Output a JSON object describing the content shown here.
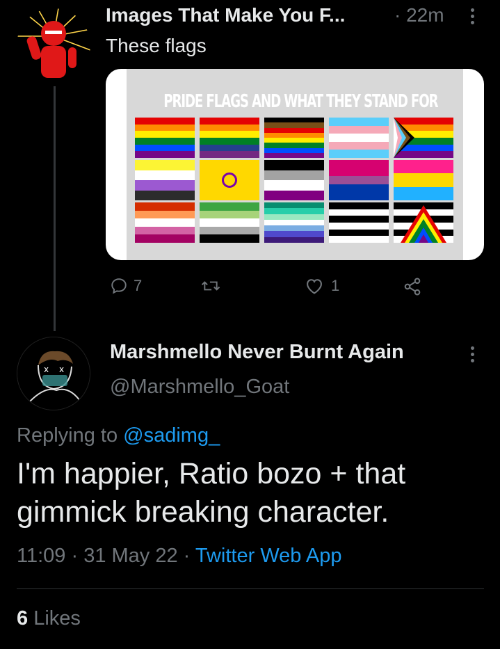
{
  "tweet": {
    "author_name": "Images That Make You F...",
    "time": "· 22m",
    "text": "These flags",
    "image_title": "PRIDE FLAGS AND WHAT THEY STAND FOR",
    "actions": {
      "reply_count": "7",
      "retweet_count": "",
      "like_count": "1"
    }
  },
  "reply": {
    "author_name": "Marshmello Never Burnt Again",
    "handle": "@Marshmello_Goat",
    "replying_prefix": "Replying to ",
    "replying_mention": "@sadimg_",
    "text": "I'm happier, Ratio bozo + that gimmick breaking character.",
    "time": "11:09 · 31 May 22 · ",
    "app": "Twitter Web App",
    "likes_count": "6",
    "likes_label": " Likes"
  },
  "colors": {
    "background": "#000000",
    "text_primary": "#e7e9ea",
    "text_secondary": "#71767b",
    "link": "#1d9bf0",
    "divider": "#2f3336"
  },
  "flags": [
    {
      "name": "rainbow-flag",
      "stripes": [
        "#e40303",
        "#ff8c00",
        "#ffed00",
        "#008026",
        "#004dff",
        "#750787"
      ]
    },
    {
      "name": "rainbow-flag-alt",
      "stripes": [
        "#e40303",
        "#ff8c00",
        "#ffed00",
        "#008026",
        "#24408e",
        "#732982"
      ]
    },
    {
      "name": "philadelphia-flag",
      "stripes": [
        "#000000",
        "#784f17",
        "#e40303",
        "#ff8c00",
        "#ffed00",
        "#008026",
        "#004dff",
        "#750787"
      ]
    },
    {
      "name": "transgender-flag",
      "stripes": [
        "#5bcefa",
        "#f5a9b8",
        "#ffffff",
        "#f5a9b8",
        "#5bcefa"
      ]
    },
    {
      "name": "progress-flag",
      "stripes": [
        "#e40303",
        "#ff8c00",
        "#ffed00",
        "#008026",
        "#004dff",
        "#750787"
      ]
    },
    {
      "name": "nonbinary-flag",
      "stripes": [
        "#fcf434",
        "#ffffff",
        "#9c59d1",
        "#2c2c2c"
      ]
    },
    {
      "name": "intersex-flag",
      "stripes": [
        "#ffd800"
      ]
    },
    {
      "name": "asexual-flag",
      "stripes": [
        "#000000",
        "#a3a3a3",
        "#ffffff",
        "#800080"
      ]
    },
    {
      "name": "bisexual-flag",
      "stripes": [
        "#d60270",
        "#d60270",
        "#9b4f96",
        "#0038a8",
        "#0038a8"
      ]
    },
    {
      "name": "pansexual-flag",
      "stripes": [
        "#ff218c",
        "#ffd800",
        "#21b1ff"
      ]
    },
    {
      "name": "lesbian-flag",
      "stripes": [
        "#d52d00",
        "#ff9a56",
        "#ffffff",
        "#d362a4",
        "#a30262"
      ]
    },
    {
      "name": "aromantic-flag",
      "stripes": [
        "#3da542",
        "#a7d379",
        "#ffffff",
        "#a9a9a9",
        "#000000"
      ]
    },
    {
      "name": "gay-men-flag",
      "stripes": [
        "#078d70",
        "#26ceaa",
        "#98e8c1",
        "#ffffff",
        "#7bade2",
        "#5049cc",
        "#3d1a78"
      ]
    },
    {
      "name": "straight-ally-flag",
      "stripes": [
        "#000000",
        "#ffffff",
        "#000000",
        "#ffffff",
        "#000000",
        "#ffffff"
      ]
    },
    {
      "name": "ally-flag",
      "stripes": [
        "#000000",
        "#ffffff",
        "#000000",
        "#ffffff",
        "#000000",
        "#ffffff"
      ]
    }
  ]
}
